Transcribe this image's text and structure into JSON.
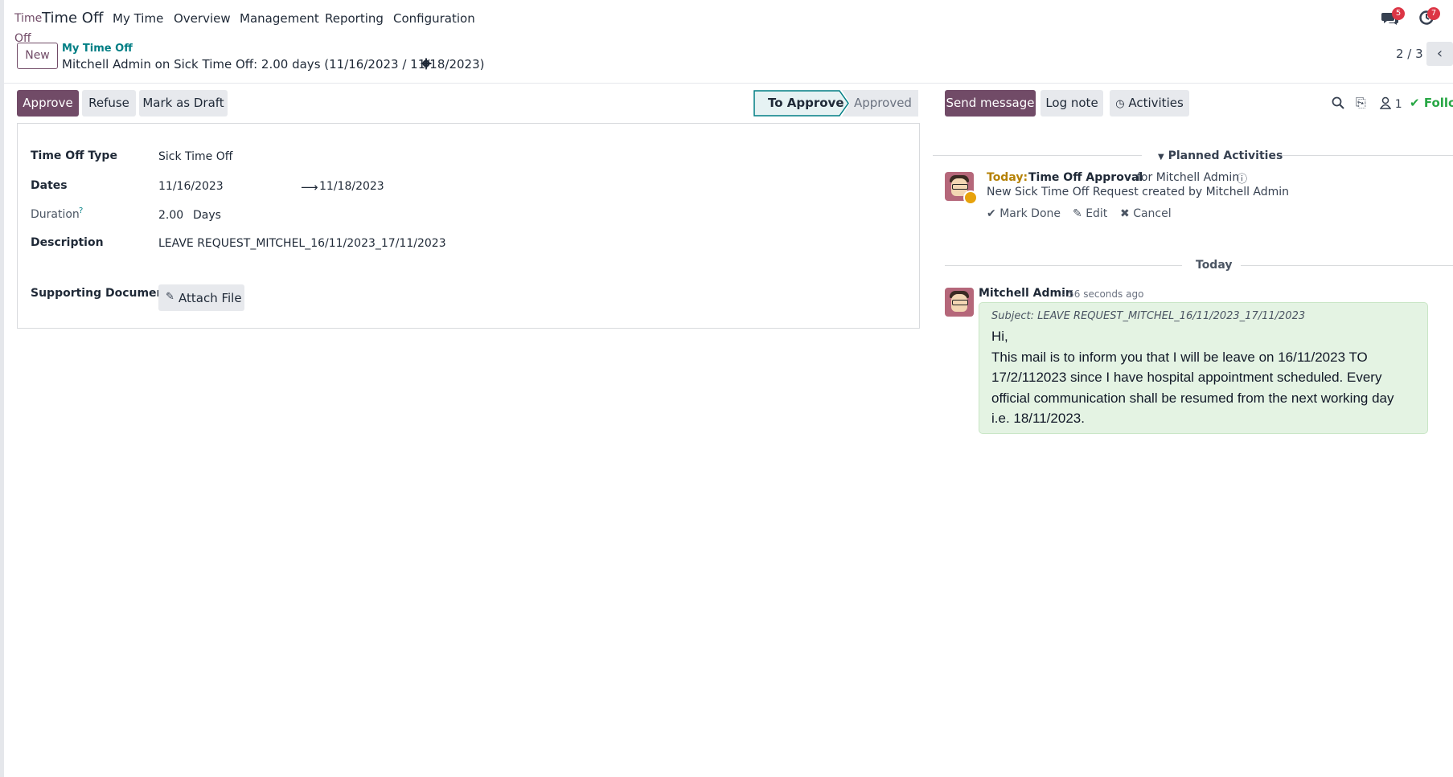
{
  "nav": {
    "logo_small": "Time",
    "logo_off": "Off",
    "app_name": "Time Off",
    "menu": [
      "My Time",
      "Overview",
      "Management",
      "Reporting",
      "Configuration"
    ],
    "messages_badge": "5",
    "activities_badge": "7"
  },
  "breadcrumb": {
    "new_label": "New",
    "parent": "My Time Off",
    "record_title": "Mitchell Admin on Sick Time Off: 2.00 days (11/16/2023 / 11/18/2023)",
    "pager": "2 / 3"
  },
  "statusbar": {
    "approve": "Approve",
    "refuse": "Refuse",
    "mark_draft": "Mark as Draft",
    "stages": [
      "To Approve",
      "Approved"
    ],
    "current_stage": "To Approve"
  },
  "form": {
    "type_label": "Time Off Type",
    "type_value": "Sick Time Off",
    "dates_label": "Dates",
    "date_from": "11/16/2023",
    "date_to": "11/18/2023",
    "duration_label": "Duration",
    "duration_help": "?",
    "duration_value": "2.00",
    "duration_unit": "Days",
    "description_label": "Description",
    "description_value": "LEAVE REQUEST_MITCHEL_16/11/2023_17/11/2023",
    "document_label": "Supporting Document",
    "attach_label": "Attach File"
  },
  "chatter": {
    "send_message": "Send message",
    "log_note": "Log note",
    "activities": "Activities",
    "followers_count": "1",
    "follow_label": "Following",
    "planned_title": "Planned Activities",
    "activity": {
      "when": "Today:",
      "name": "Time Off Approval",
      "for": "for Mitchell Admin",
      "summary": "New Sick Time Off Request created by Mitchell Admin",
      "mark_done": "Mark Done",
      "edit": "Edit",
      "cancel": "Cancel"
    },
    "date_separator": "Today",
    "message": {
      "author": "Mitchell Admin",
      "time": "- 56 seconds ago",
      "subject": "Subject: LEAVE REQUEST_MITCHEL_16/11/2023_17/11/2023",
      "line1": "Hi,",
      "line2": "This mail is to inform you that I will be leave on 16/11/2023 TO",
      "line3": "17/2/112023 since I have hospital appointment scheduled. Every",
      "line4": "official communication shall be resumed from the next working day",
      "line5": "i.e. 18/11/2023."
    }
  }
}
